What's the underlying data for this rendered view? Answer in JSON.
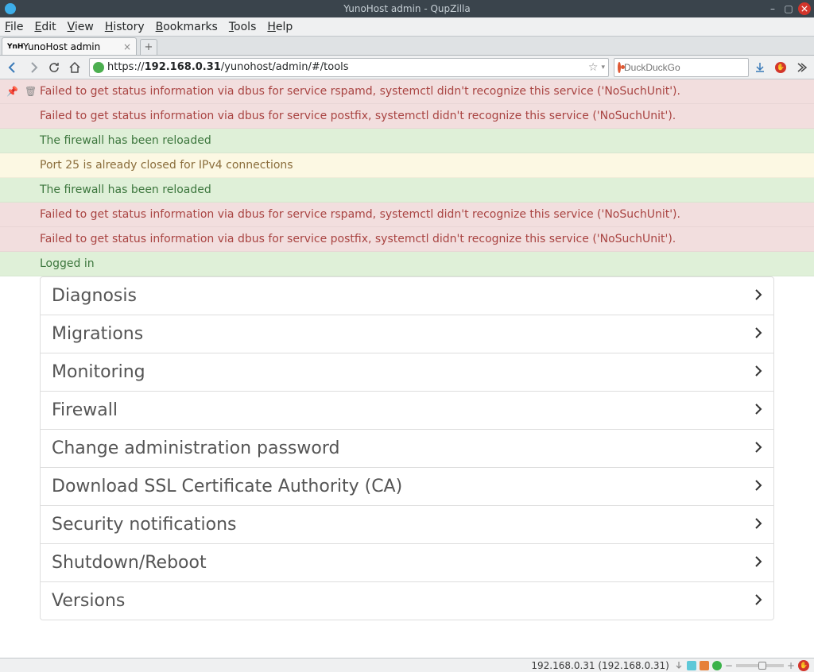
{
  "window": {
    "title": "YunoHost admin - QupZilla"
  },
  "menubar": [
    "File",
    "Edit",
    "View",
    "History",
    "Bookmarks",
    "Tools",
    "Help"
  ],
  "tab": {
    "title": "YunoHost admin",
    "favicon": "YnH"
  },
  "url": {
    "scheme": "https://",
    "host": "192.168.0.31",
    "path": "/yunohost/admin/#/tools"
  },
  "search": {
    "placeholder": "DuckDuckGo"
  },
  "messages": [
    {
      "type": "error",
      "text": "Failed to get status information via dbus for service rspamd, systemctl didn't recognize this service ('NoSuchUnit')."
    },
    {
      "type": "error",
      "text": "Failed to get status information via dbus for service postfix, systemctl didn't recognize this service ('NoSuchUnit')."
    },
    {
      "type": "success",
      "text": "The firewall has been reloaded"
    },
    {
      "type": "warning",
      "text": "Port 25 is already closed for IPv4 connections"
    },
    {
      "type": "success",
      "text": "The firewall has been reloaded"
    },
    {
      "type": "error",
      "text": "Failed to get status information via dbus for service rspamd, systemctl didn't recognize this service ('NoSuchUnit')."
    },
    {
      "type": "error",
      "text": "Failed to get status information via dbus for service postfix, systemctl didn't recognize this service ('NoSuchUnit')."
    },
    {
      "type": "success",
      "text": "Logged in"
    }
  ],
  "tools": [
    {
      "label": "Diagnosis"
    },
    {
      "label": "Migrations"
    },
    {
      "label": "Monitoring"
    },
    {
      "label": "Firewall"
    },
    {
      "label": "Change administration password"
    },
    {
      "label": "Download SSL Certificate Authority (CA)"
    },
    {
      "label": "Security notifications"
    },
    {
      "label": "Shutdown/Reboot"
    },
    {
      "label": "Versions"
    }
  ],
  "statusbar": {
    "text": "192.168.0.31 (192.168.0.31)"
  }
}
